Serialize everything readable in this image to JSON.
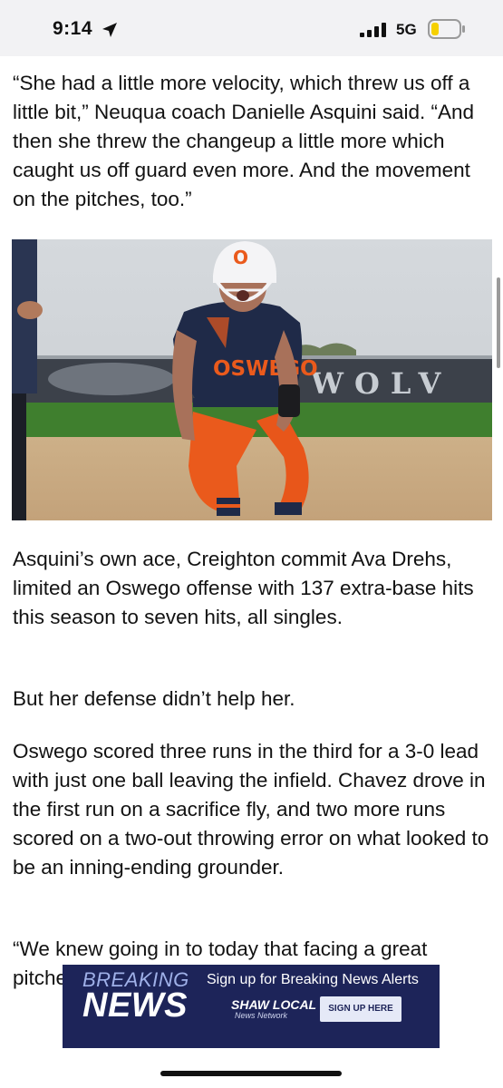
{
  "status_bar": {
    "time": "9:14",
    "network": "5G",
    "icons": [
      "location-arrow-icon",
      "signal-bars-icon",
      "battery-icon"
    ],
    "battery_color": "#f5d000"
  },
  "article": {
    "paragraphs": [
      "“She had a little more velocity, which threw us off a little bit,” Neuqua coach Danielle Asquini said. “And then she threw the changeup a little more which caught us off guard even more. And the movement on the pitches, too.”",
      "Asquini’s own ace, Creighton commit Ava Drehs, limited an Oswego offense with 137 extra-base hits this season to seven hits, all singles.",
      "But her defense didn’t help her.",
      "Oswego scored three runs in the third for a 3-0 lead with just one ball leaving the infield. Chavez drove in the first run on a sacrifice fly, and two more runs scored on a two-out throwing error on what looked to be an inning-ending grounder.",
      "“We knew going in to today that facing a great pitcher that we’d need our small ball and clutch"
    ],
    "photo": {
      "helmet_letter": "O",
      "jersey_text": "OSWEGO",
      "wall_text": "WOLV",
      "colors": {
        "orange": "#ea5a1c",
        "navy": "#1f2a48",
        "grass": "#3d7d2c",
        "dirt": "#c8a77c"
      }
    }
  },
  "ad": {
    "line1": "BREAKING",
    "line2": "NEWS",
    "tagline": "Sign up for Breaking News Alerts",
    "brand": "SHAW LOCAL",
    "brand_sub": "News Network",
    "cta": "SIGN UP HERE",
    "background": "#1d2459"
  }
}
